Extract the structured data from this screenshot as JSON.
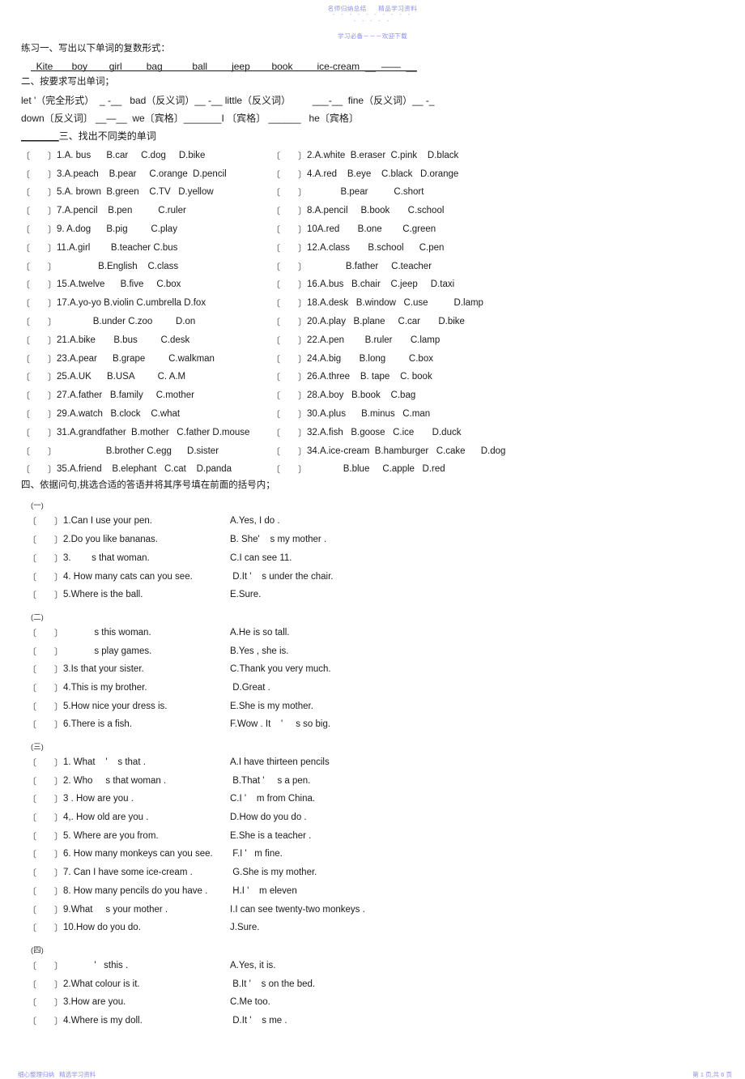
{
  "watermark": {
    "header_line1_a": "名师归纳总结",
    "header_line1_b": "精品学习资料",
    "header_dashes_1": "- - - - - - - - - -",
    "header_dashes_2": "- - - - -",
    "header_line2": "学习必备－－－欢迎下载",
    "footer_left": "细心整理归纳   精选学习资料",
    "footer_right": "第 1 页,共 6 页",
    "color": "#8c8cf0"
  },
  "ex1": {
    "title": "练习一、写出以下单词的复数形式：",
    "words_line": "  Kite       boy        girl         bag           ball         jeep        book         ice-cream  __  ——  __"
  },
  "ex2": {
    "title": "二、按要求写出单词；",
    "line1": "let '（完全形式）  _ -__   bad（反义词）__ -__ little（反义词）        ___-__  fine（反义词）__ -_",
    "line2": "down〔反义词〕 __—__  we〔宾格〕_______I 〔宾格〕 ______   he〔宾格〕",
    "line3_lead": "_______",
    "line3": "三、找出不同类的单词"
  },
  "mc_rows": [
    {
      "left_num": "1.A. bus      B.car     C.dog     D.bike",
      "right_num": "2.A.white  B.eraser  C.pink    D.black"
    },
    {
      "left_num": "3.A.peach    B.pear     C.orange  D.pencil",
      "right_num": "4.A.red    B.eye    C.black   D.orange"
    },
    {
      "left_num": "5.A. brown  B.green    C.TV   D.yellow",
      "right_num": "             B.pear          C.short"
    },
    {
      "left_num": "7.A.pencil    B.pen          C.ruler",
      "right_num": "8.A.pencil     B.book       C.school"
    },
    {
      "left_num": "9. A.dog      B.pig         C.play",
      "right_num": "10A.red       B.one        C.green"
    },
    {
      "left_num": "11.A.girl        B.teacher C.bus",
      "right_num": "12.A.class       B.school      C.pen"
    },
    {
      "left_num": "                B.English    C.class",
      "right_num": "               B.father     C.teacher"
    },
    {
      "left_num": "15.A.twelve      B.five     C.box",
      "right_num": "16.A.bus   B.chair    C.jeep     D.taxi"
    },
    {
      "left_num": "17.A.yo-yo B.violin C.umbrella D.fox",
      "right_num": "18.A.desk   B.window   C.use          D.lamp"
    },
    {
      "left_num": "              B.under C.zoo         D.on",
      "right_num": "20.A.play   B.plane     C.car       D.bike"
    },
    {
      "left_num": "21.A.bike       B.bus         C.desk",
      "right_num": "22.A.pen        B.ruler       C.lamp"
    },
    {
      "left_num": "23.A.pear      B.grape         C.walkman",
      "right_num": "24.A.big       B.long         C.box"
    },
    {
      "left_num": "25.A.UK      B.USA         C. A.M",
      "right_num": "26.A.three    B. tape    C. book"
    },
    {
      "left_num": "27.A.father   B.family     C.mother",
      "right_num": "28.A.boy   B.book    C.bag"
    },
    {
      "left_num": "29.A.watch   B.clock    C.what",
      "right_num": "30.A.plus      B.minus   C.man"
    },
    {
      "left_num": "31.A.grandfather  B.mother   C.father D.mouse",
      "right_num": "32.A.fish   B.goose   C.ice       D.duck"
    },
    {
      "left_num": "                   B.brother C.egg      D.sister",
      "right_num": "34.A.ice-cream  B.hamburger   C.cake      D.dog"
    },
    {
      "left_num": "35.A.friend    B.elephant   C.cat    D.panda",
      "right_num": "              B.blue     C.apple   D.red"
    }
  ],
  "ex4": {
    "title": "四、依据问句,挑选合适的答语并将其序号填在前面的括号内；",
    "groups": [
      {
        "label": "(一)",
        "rows": [
          {
            "q": "1.Can I use your pen.",
            "a": "A.Yes, I do ."
          },
          {
            "q": "2.Do you like bananas.",
            "a": "B. She'    s my mother ."
          },
          {
            "q": "3.        s that woman.",
            "a": "C.I can see 11."
          },
          {
            "q": "4. How many cats can you see.",
            "a": " D.It '    s under the chair."
          },
          {
            "q": "5.Where is the ball.",
            "a": "E.Sure."
          }
        ]
      },
      {
        "label": "(二)",
        "rows": [
          {
            "q": "            s this woman.",
            "a": "A.He is so tall."
          },
          {
            "q": "            s play games.",
            "a": "B.Yes , she is."
          },
          {
            "q": "3.Is that your sister.",
            "a": "C.Thank you very much."
          },
          {
            "q": "4.This is my brother.",
            "a": " D.Great ."
          },
          {
            "q": "5.How nice your dress is.",
            "a": "E.She is my mother."
          },
          {
            "q": "6.There is a fish.",
            "a": "F.Wow . It    '     s so big."
          }
        ]
      },
      {
        "label": "(三)",
        "rows": [
          {
            "q": "1. What    '    s that .",
            "a": "A.I have thirteen pencils"
          },
          {
            "q": "2. Who     s that woman .",
            "a": " B.That '     s a pen."
          },
          {
            "q": "3 . How are you .",
            "a": "C.I '    m from China."
          },
          {
            "q": "4,. How old are you .",
            "a": "D.How do you do ."
          },
          {
            "q": "5. Where are you from.",
            "a": "E.She is a teacher ."
          },
          {
            "q": "6. How many monkeys can you see.",
            "a": " F.I '   m fine."
          },
          {
            "q": "7. Can I have some ice-cream .",
            "a": " G.She is my mother."
          },
          {
            "q": "8. How many pencils do you have .",
            "a": " H.I '    m eleven"
          },
          {
            "q": "9.What     s your mother .",
            "a": "I.I can see twenty-two monkeys ."
          },
          {
            "q": "10.How do you do.",
            "a": "J.Sure."
          }
        ]
      },
      {
        "label": "(四)",
        "rows": [
          {
            "q": "            '   sthis .",
            "a": "A.Yes, it is."
          },
          {
            "q": "2.What colour is it.",
            "a": " B.It '    s on the bed."
          },
          {
            "q": "3.How are you.",
            "a": "C.Me too."
          },
          {
            "q": "4.Where is my doll.",
            "a": " D.It '    s me ."
          }
        ]
      }
    ]
  }
}
